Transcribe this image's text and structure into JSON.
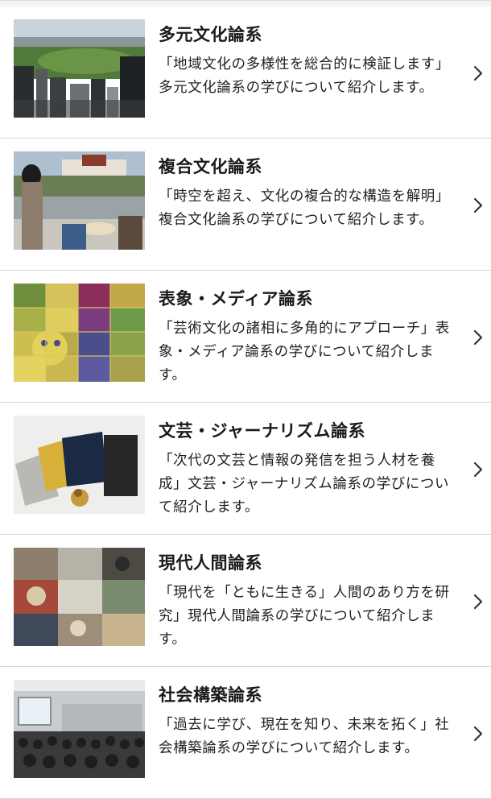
{
  "items": [
    {
      "title": "多元文化論系",
      "description": "「地域文化の多様性を総合的に検証します」多元文化論系の学びについて紹介します。",
      "thumbnail_icon": "city-park-photo"
    },
    {
      "title": "複合文化論系",
      "description": "「時空を超え、文化の複合的な構造を解明」複合文化論系の学びについて紹介します。",
      "thumbnail_icon": "tibet-palace-photo"
    },
    {
      "title": "表象・メディア論系",
      "description": "「芸術文化の諸相に多角的にアプローチ」表象・メディア論系の学びについて紹介します。",
      "thumbnail_icon": "mosaic-art-photo"
    },
    {
      "title": "文芸・ジャーナリズム論系",
      "description": "「次代の文芸と情報の発信を担う人材を養成」文芸・ジャーナリズム論系の学びについて紹介します。",
      "thumbnail_icon": "books-photo"
    },
    {
      "title": "現代人間論系",
      "description": "「現代を「ともに生きる」人間のあり方を研究」現代人間論系の学びについて紹介します。",
      "thumbnail_icon": "collage-photo"
    },
    {
      "title": "社会構築論系",
      "description": "「過去に学び、現在を知り、未来を拓く」社会構築論系の学びについて紹介します。",
      "thumbnail_icon": "lecture-hall-photo"
    }
  ]
}
